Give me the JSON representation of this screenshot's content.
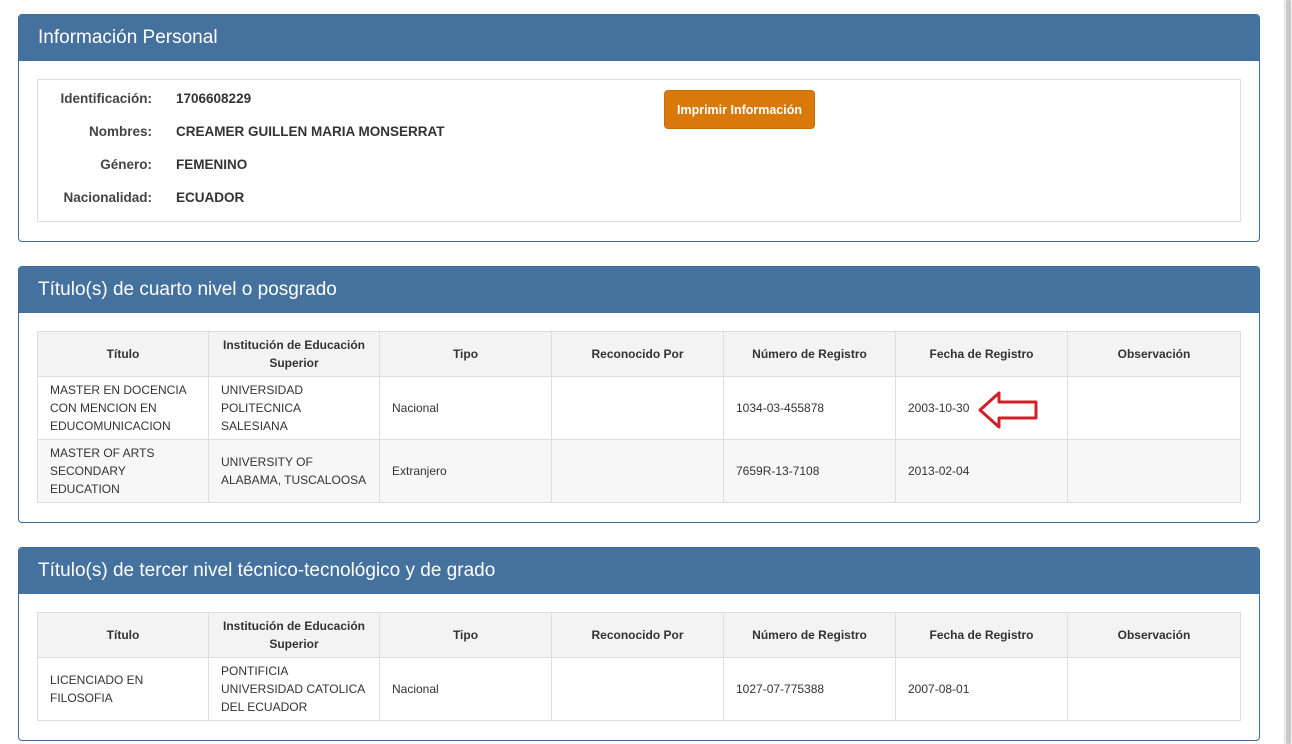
{
  "personal": {
    "title": "Información Personal",
    "fields": [
      {
        "label": "Identificación:",
        "value": "1706608229"
      },
      {
        "label": "Nombres:",
        "value": "CREAMER GUILLEN MARIA MONSERRAT"
      },
      {
        "label": "Género:",
        "value": "FEMENINO"
      },
      {
        "label": "Nacionalidad:",
        "value": "ECUADOR"
      }
    ],
    "print_label": "Imprimir Información"
  },
  "columns": [
    "Título",
    "Institución de Educación Superior",
    "Tipo",
    "Reconocido Por",
    "Número de Registro",
    "Fecha de Registro",
    "Observación"
  ],
  "fourth_level": {
    "title": "Título(s) de cuarto nivel o posgrado",
    "rows": [
      {
        "titulo": "MASTER EN DOCENCIA CON MENCION EN EDUCOMUNICACION",
        "institucion": "UNIVERSIDAD POLITECNICA SALESIANA",
        "tipo": "Nacional",
        "reconocido": "",
        "registro": "1034-03-455878",
        "fecha": "2003-10-30",
        "observacion": ""
      },
      {
        "titulo": "MASTER OF ARTS SECONDARY EDUCATION",
        "institucion": "UNIVERSITY OF ALABAMA, TUSCALOOSA",
        "tipo": "Extranjero",
        "reconocido": "",
        "registro": "7659R-13-7108",
        "fecha": "2013-02-04",
        "observacion": ""
      }
    ]
  },
  "third_level": {
    "title": "Título(s) de tercer nivel técnico-tecnológico y de grado",
    "rows": [
      {
        "titulo": "LICENCIADO EN FILOSOFIA",
        "institucion": "PONTIFICIA UNIVERSIDAD CATOLICA DEL ECUADOR",
        "tipo": "Nacional",
        "reconocido": "",
        "registro": "1027-07-775388",
        "fecha": "2007-08-01",
        "observacion": ""
      }
    ]
  },
  "colors": {
    "heading_bg": "#45719f",
    "button_bg": "#d9790a",
    "annotation": "#d0202a"
  },
  "annotation_icon": "red-arrow-left-icon"
}
